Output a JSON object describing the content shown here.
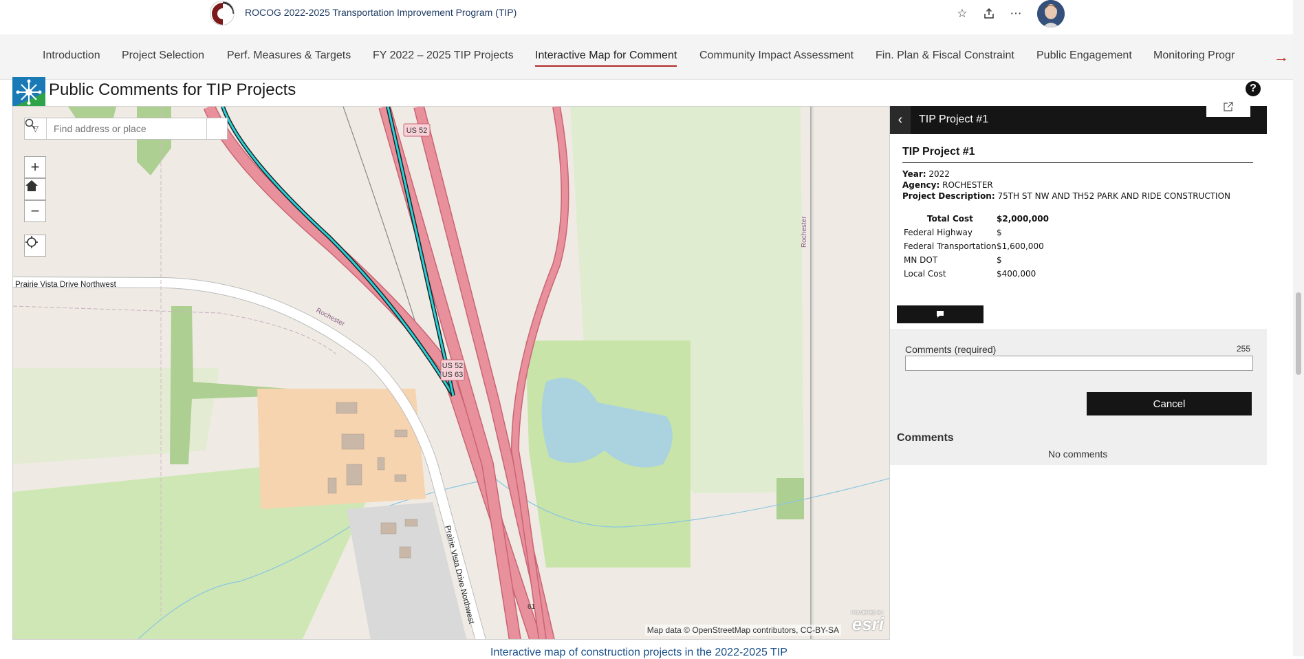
{
  "header": {
    "app_title": "ROCOG 2022-2025 Transportation Improvement Program (TIP)",
    "icons": [
      "star-icon",
      "share-icon",
      "more-icon"
    ]
  },
  "nav": {
    "items": [
      {
        "label": "Introduction"
      },
      {
        "label": "Project Selection"
      },
      {
        "label": "Perf. Measures & Targets"
      },
      {
        "label": "FY 2022 – 2025 TIP Projects"
      },
      {
        "label": "Interactive Map for Comment"
      },
      {
        "label": "Community Impact Assessment"
      },
      {
        "label": "Fin. Plan & Fiscal Constraint"
      },
      {
        "label": "Public Engagement"
      },
      {
        "label": "Monitoring Progr"
      }
    ],
    "active_index": 4,
    "next_arrow": "→"
  },
  "widget": {
    "title": "Public Comments for TIP Projects"
  },
  "map": {
    "search_placeholder": "Find address or place",
    "labels": {
      "prairie_vista_west": "Prairie Vista Drive Northwest",
      "prairie_vista_south": "Prairie Vista Drive Northwest",
      "rochester_1": "Rochester",
      "rochester_2": "Rochester",
      "us52_top": "US 52",
      "us52_mid": "US 52",
      "us63_mid": "US 63",
      "route_61": "61"
    },
    "attribution": "Map data © OpenStreetMap contributors, CC-BY-SA",
    "esri_powered": "POWERED BY",
    "esri": "esri",
    "colors": {
      "highway": "#e8909c",
      "highlight": "#2ad1d8",
      "park": "#c8e4a8",
      "water": "#aad3df",
      "residential": "#f7d4b0",
      "commercial": "#d9d9d9"
    }
  },
  "popup": {
    "header_title": "TIP Project #1",
    "title": "TIP Project #1",
    "fields": [
      {
        "label": "Year:",
        "value": "2022"
      },
      {
        "label": "Agency:",
        "value": "ROCHESTER"
      },
      {
        "label": "Project Description:",
        "value": "75TH ST NW AND TH52 PARK AND RIDE CONSTRUCTION"
      }
    ],
    "costs": {
      "total_label": "Total Cost",
      "total_value": "$2,000,000",
      "rows": [
        {
          "label": "Federal Highway",
          "value": "$"
        },
        {
          "label": "Federal Transportation",
          "value": "$1,600,000"
        },
        {
          "label": "MN DOT",
          "value": "$"
        },
        {
          "label": "Local Cost",
          "value": "$400,000"
        }
      ]
    },
    "comments_label": "Comments (required)",
    "comments_remaining": "255",
    "cancel_label": "Cancel",
    "comments_heading": "Comments",
    "no_comments": "No comments"
  },
  "caption": "Interactive map of construction projects in the 2022-2025 TIP"
}
